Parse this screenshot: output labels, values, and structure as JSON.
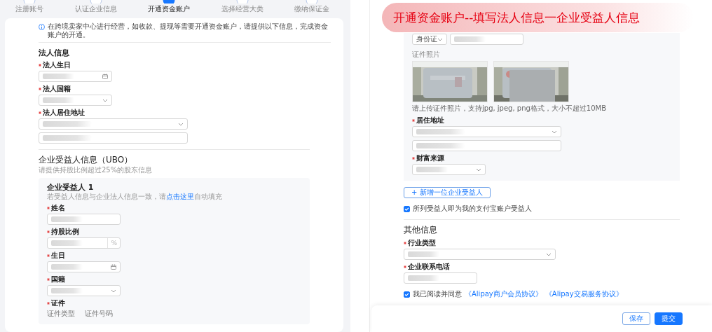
{
  "steps": [
    {
      "label": "注册账号",
      "selected": false
    },
    {
      "label": "认证企业信息",
      "selected": false
    },
    {
      "label": "开通资金账户",
      "selected": true
    },
    {
      "label": "选择经营大类",
      "selected": false
    },
    {
      "label": "缴纳保证金",
      "selected": false
    }
  ],
  "left": {
    "notice": "在跨境卖家中心进行经营，如收款、提现等需要开通资金账户，请提供以下信息，完成资金账户的开通。",
    "legal_section": {
      "title": "法人信息",
      "fields": [
        {
          "label": "法人生日",
          "required": true,
          "kind": "date"
        },
        {
          "label": "法人国籍",
          "required": true,
          "kind": "select"
        },
        {
          "label": "法人居住地址",
          "required": true,
          "kind": "address"
        }
      ]
    },
    "ubo_section": {
      "title": "企业受益人信息（UBO）",
      "subtitle": "请提供持股比例超过25%的股东信息",
      "beneficiary": {
        "title": "企业受益人 1",
        "hint_before": "若受益人信息与企业法人信息一致，请",
        "hint_link": "点击这里",
        "hint_after": "自动填充",
        "fields": [
          {
            "label": "姓名",
            "required": true,
            "kind": "text"
          },
          {
            "label": "持股比例",
            "required": true,
            "kind": "percent",
            "unit": "%"
          },
          {
            "label": "生日",
            "required": true,
            "kind": "date"
          },
          {
            "label": "国籍",
            "required": true,
            "kind": "select"
          },
          {
            "label": "证件",
            "required": true,
            "kind": "id",
            "sub_labels": [
              "证件类型",
              "证件号码"
            ]
          }
        ]
      }
    }
  },
  "right": {
    "banner": "开通资金账户--填写法人信息一企业受益人信息",
    "id_type": "身份证",
    "photo_label": "证件照片",
    "photo_hint": "请上传证件照片，支持jpg, jpeg, png格式，大小不超过10MB",
    "fields": [
      {
        "label": "居住地址",
        "required": true,
        "kind": "address"
      },
      {
        "label": "财富来源",
        "required": true,
        "kind": "select"
      }
    ],
    "add_button": "+ 新增一位企业受益人",
    "confirm": {
      "label": "所列受益人即为我的支付宝账户受益人",
      "checked": true
    },
    "other_section": {
      "title": "其他信息",
      "fields": [
        {
          "label": "行业类型",
          "required": true,
          "kind": "wide_select"
        },
        {
          "label": "企业联系电话",
          "required": true,
          "kind": "text"
        }
      ]
    },
    "agreement": {
      "label": "我已阅读并同意",
      "links": [
        "《Alipay商户会员协议》",
        "《Alipay交易服务协议》"
      ],
      "checked": true
    },
    "buttons": [
      {
        "label": "保存",
        "kind": "secondary"
      },
      {
        "label": "提交",
        "kind": "primary"
      }
    ]
  }
}
